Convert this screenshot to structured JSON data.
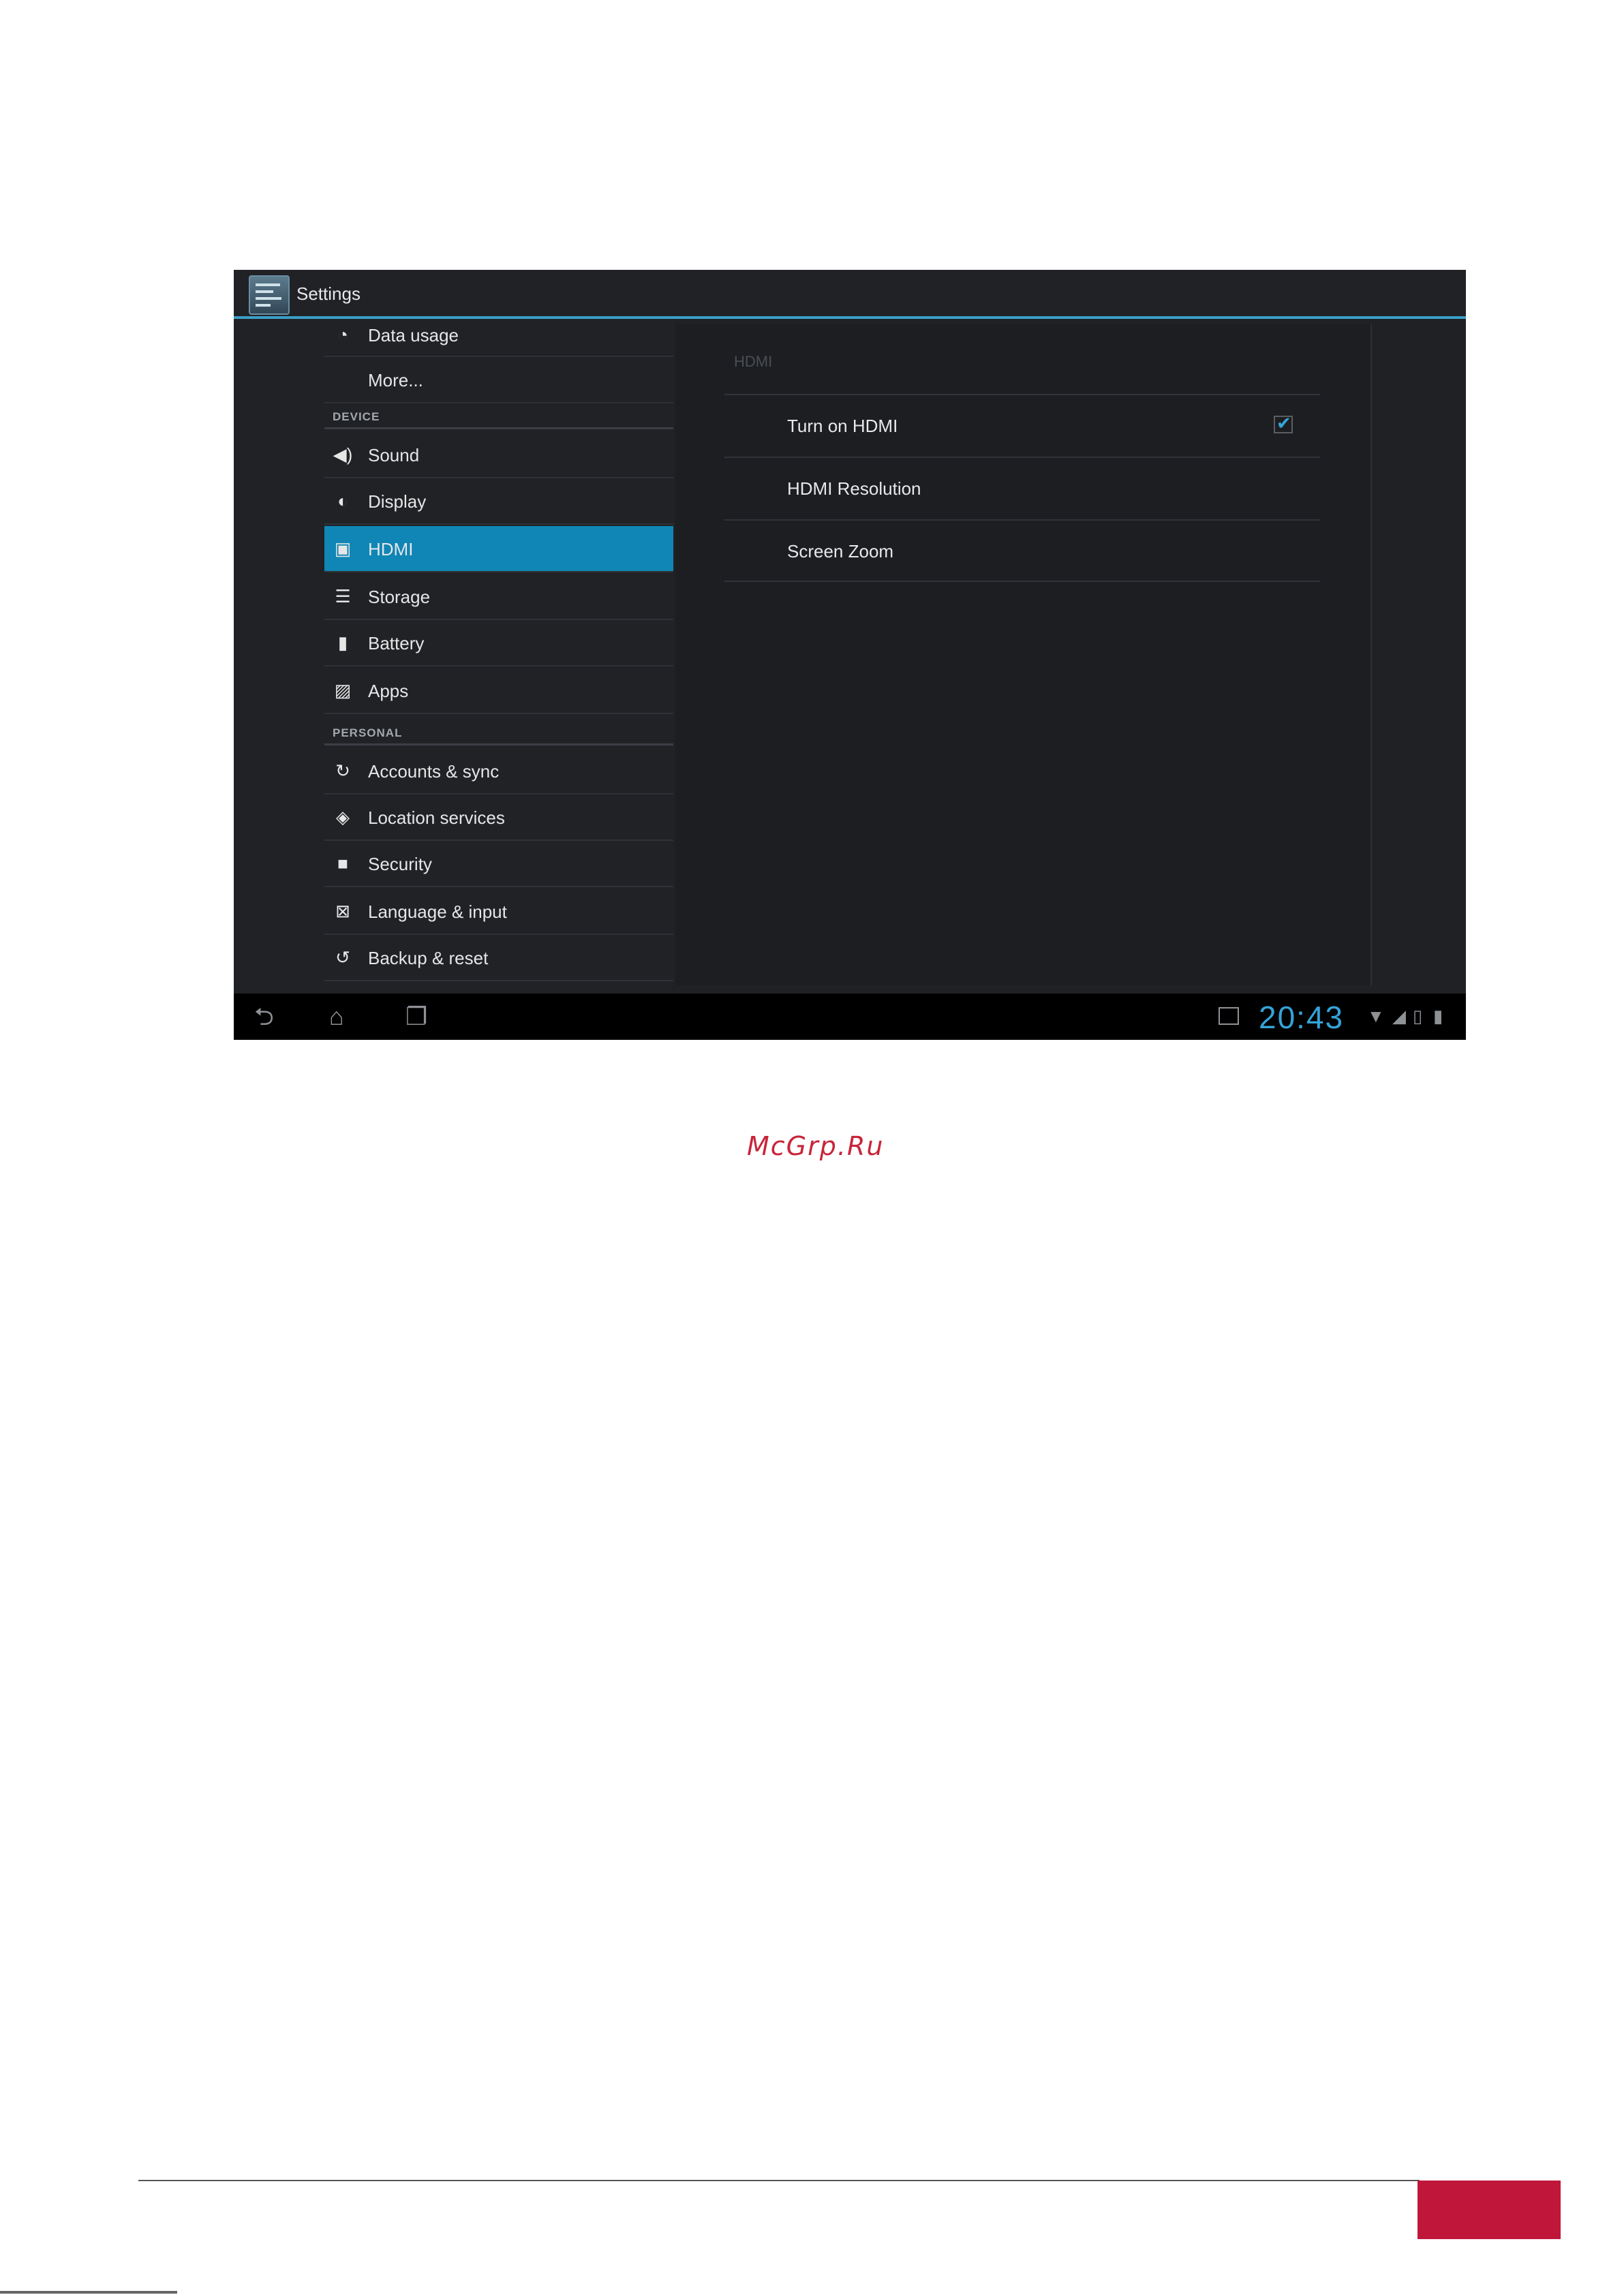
{
  "window": {
    "title": "Settings"
  },
  "sidebar": {
    "items": [
      {
        "label": "Data usage",
        "icon": "pie-chart-icon"
      },
      {
        "label": "More...",
        "icon": ""
      }
    ],
    "device_header": "DEVICE",
    "device_items": [
      {
        "label": "Sound",
        "icon": "speaker-icon"
      },
      {
        "label": "Display",
        "icon": "brightness-icon"
      },
      {
        "label": "HDMI",
        "icon": "hdmi-icon",
        "selected": true
      },
      {
        "label": "Storage",
        "icon": "storage-icon"
      },
      {
        "label": "Battery",
        "icon": "battery-icon"
      },
      {
        "label": "Apps",
        "icon": "apps-icon"
      }
    ],
    "personal_header": "PERSONAL",
    "personal_items": [
      {
        "label": "Accounts & sync",
        "icon": "sync-icon"
      },
      {
        "label": "Location services",
        "icon": "location-icon"
      },
      {
        "label": "Security",
        "icon": "lock-icon"
      },
      {
        "label": "Language & input",
        "icon": "keyboard-icon"
      },
      {
        "label": "Backup & reset",
        "icon": "restore-icon"
      }
    ]
  },
  "detail": {
    "title": "HDMI",
    "rows": [
      {
        "label": "Turn on HDMI",
        "checked": true
      },
      {
        "label": "HDMI Resolution"
      },
      {
        "label": "Screen Zoom"
      }
    ]
  },
  "statusbar": {
    "clock": "20:43"
  },
  "page": {
    "watermark": "McGrp.Ru"
  },
  "colors": {
    "accent": "#0f86b5",
    "clock": "#34a4d8",
    "brand": "#c0163a"
  }
}
